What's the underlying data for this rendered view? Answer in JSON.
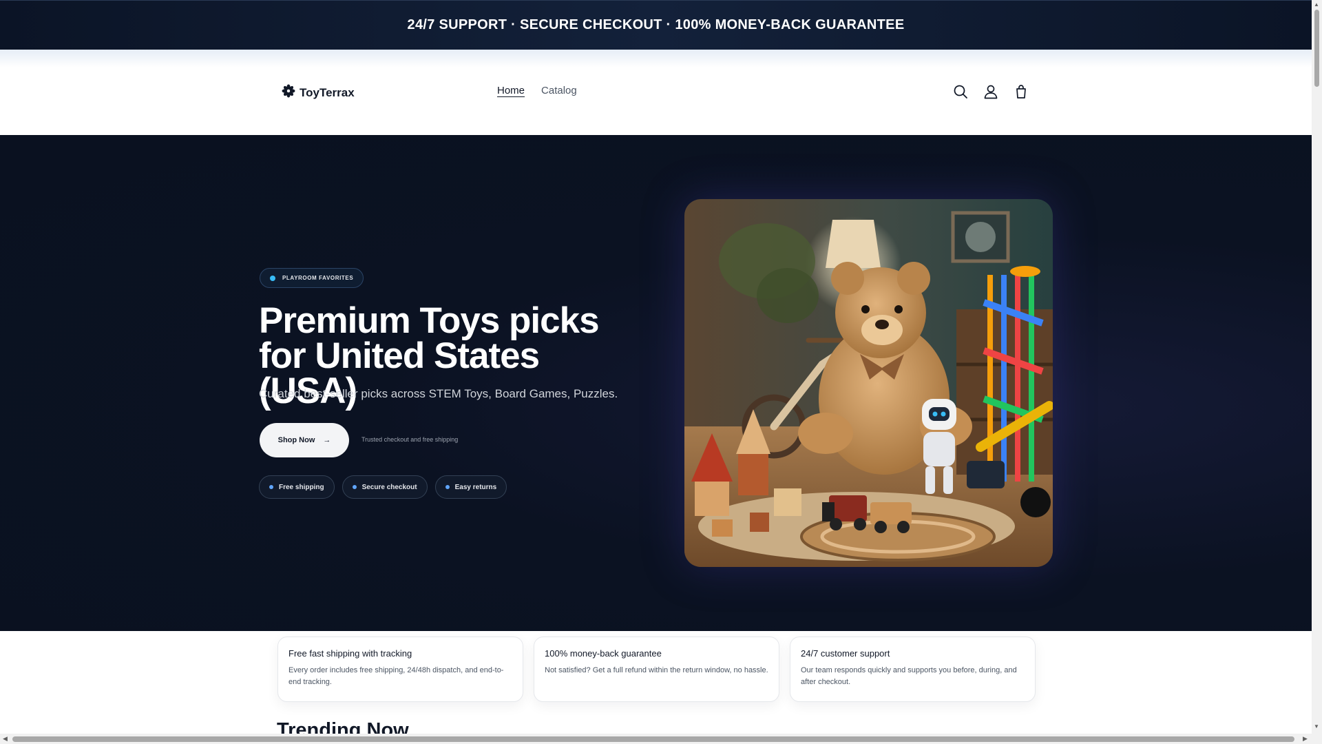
{
  "announcement": {
    "text": "24/7 SUPPORT · SECURE CHECKOUT · 100% MONEY-BACK GUARANTEE"
  },
  "header": {
    "logo_text": "ToyTerrax",
    "nav": [
      {
        "label": "Home",
        "active": true
      },
      {
        "label": "Catalog",
        "active": false
      }
    ],
    "icons": [
      "search-icon",
      "account-icon",
      "cart-icon"
    ]
  },
  "hero": {
    "eyebrow": "PLAYROOM FAVORITES",
    "title": "Premium Toys picks for United States (USA)",
    "subtitle": "Curated best-seller picks across STEM Toys, Board Games, Puzzles.",
    "cta_label": "Shop Now",
    "cta_arrow": "→",
    "trust_note": "Trusted checkout and free shipping",
    "pills": [
      "Free shipping",
      "Secure checkout",
      "Easy returns"
    ]
  },
  "features": [
    {
      "title": "Free fast shipping with tracking",
      "text": "Every order includes free shipping, 24/48h dispatch, and end-to-end tracking."
    },
    {
      "title": "100% money-back guarantee",
      "text": "Not satisfied? Get a full refund within the return window, no hassle."
    },
    {
      "title": "24/7 customer support",
      "text": "Our team responds quickly and supports you before, during, and after checkout."
    }
  ],
  "trending": {
    "heading": "Trending Now"
  },
  "colors": {
    "announcement_bg": "#0b1426",
    "hero_bg": "#0a1120",
    "accent_dot": "#38bdf8",
    "button_bg": "#f3f4f6"
  }
}
